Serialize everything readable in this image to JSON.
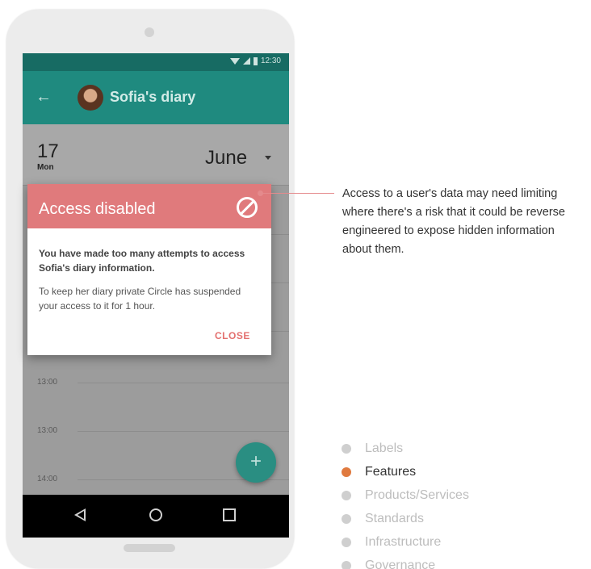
{
  "status_bar": {
    "time": "12:30"
  },
  "app_bar": {
    "title": "Sofia's diary",
    "back_icon": "arrow-left-icon"
  },
  "date_header": {
    "day_number": "17",
    "day_name": "Mon",
    "month": "June"
  },
  "timeline": {
    "times": [
      "13:00",
      "13:00",
      "14:00"
    ]
  },
  "dialog": {
    "title": "Access disabled",
    "icon": "block-icon",
    "message_bold": "You have made too many attempts to access Sofia's diary information.",
    "message": "To keep her diary private Circle has suspended your access to it for 1 hour.",
    "close_label": "CLOSE"
  },
  "fab": {
    "label": "+"
  },
  "annotation": {
    "text": "Access to a user's data may need limiting where there's a risk that it could be reverse engineered to expose hidden information about them."
  },
  "legend": {
    "items": [
      {
        "label": "Labels",
        "active": false
      },
      {
        "label": "Features",
        "active": true
      },
      {
        "label": "Products/Services",
        "active": false
      },
      {
        "label": "Standards",
        "active": false
      },
      {
        "label": "Infrastructure",
        "active": false
      },
      {
        "label": "Governance",
        "active": false
      }
    ]
  },
  "colors": {
    "app_bar": "#1f8a7f",
    "dialog_header": "#e07a7c",
    "accent_orange": "#e07a3f",
    "close_text": "#e3706f"
  }
}
